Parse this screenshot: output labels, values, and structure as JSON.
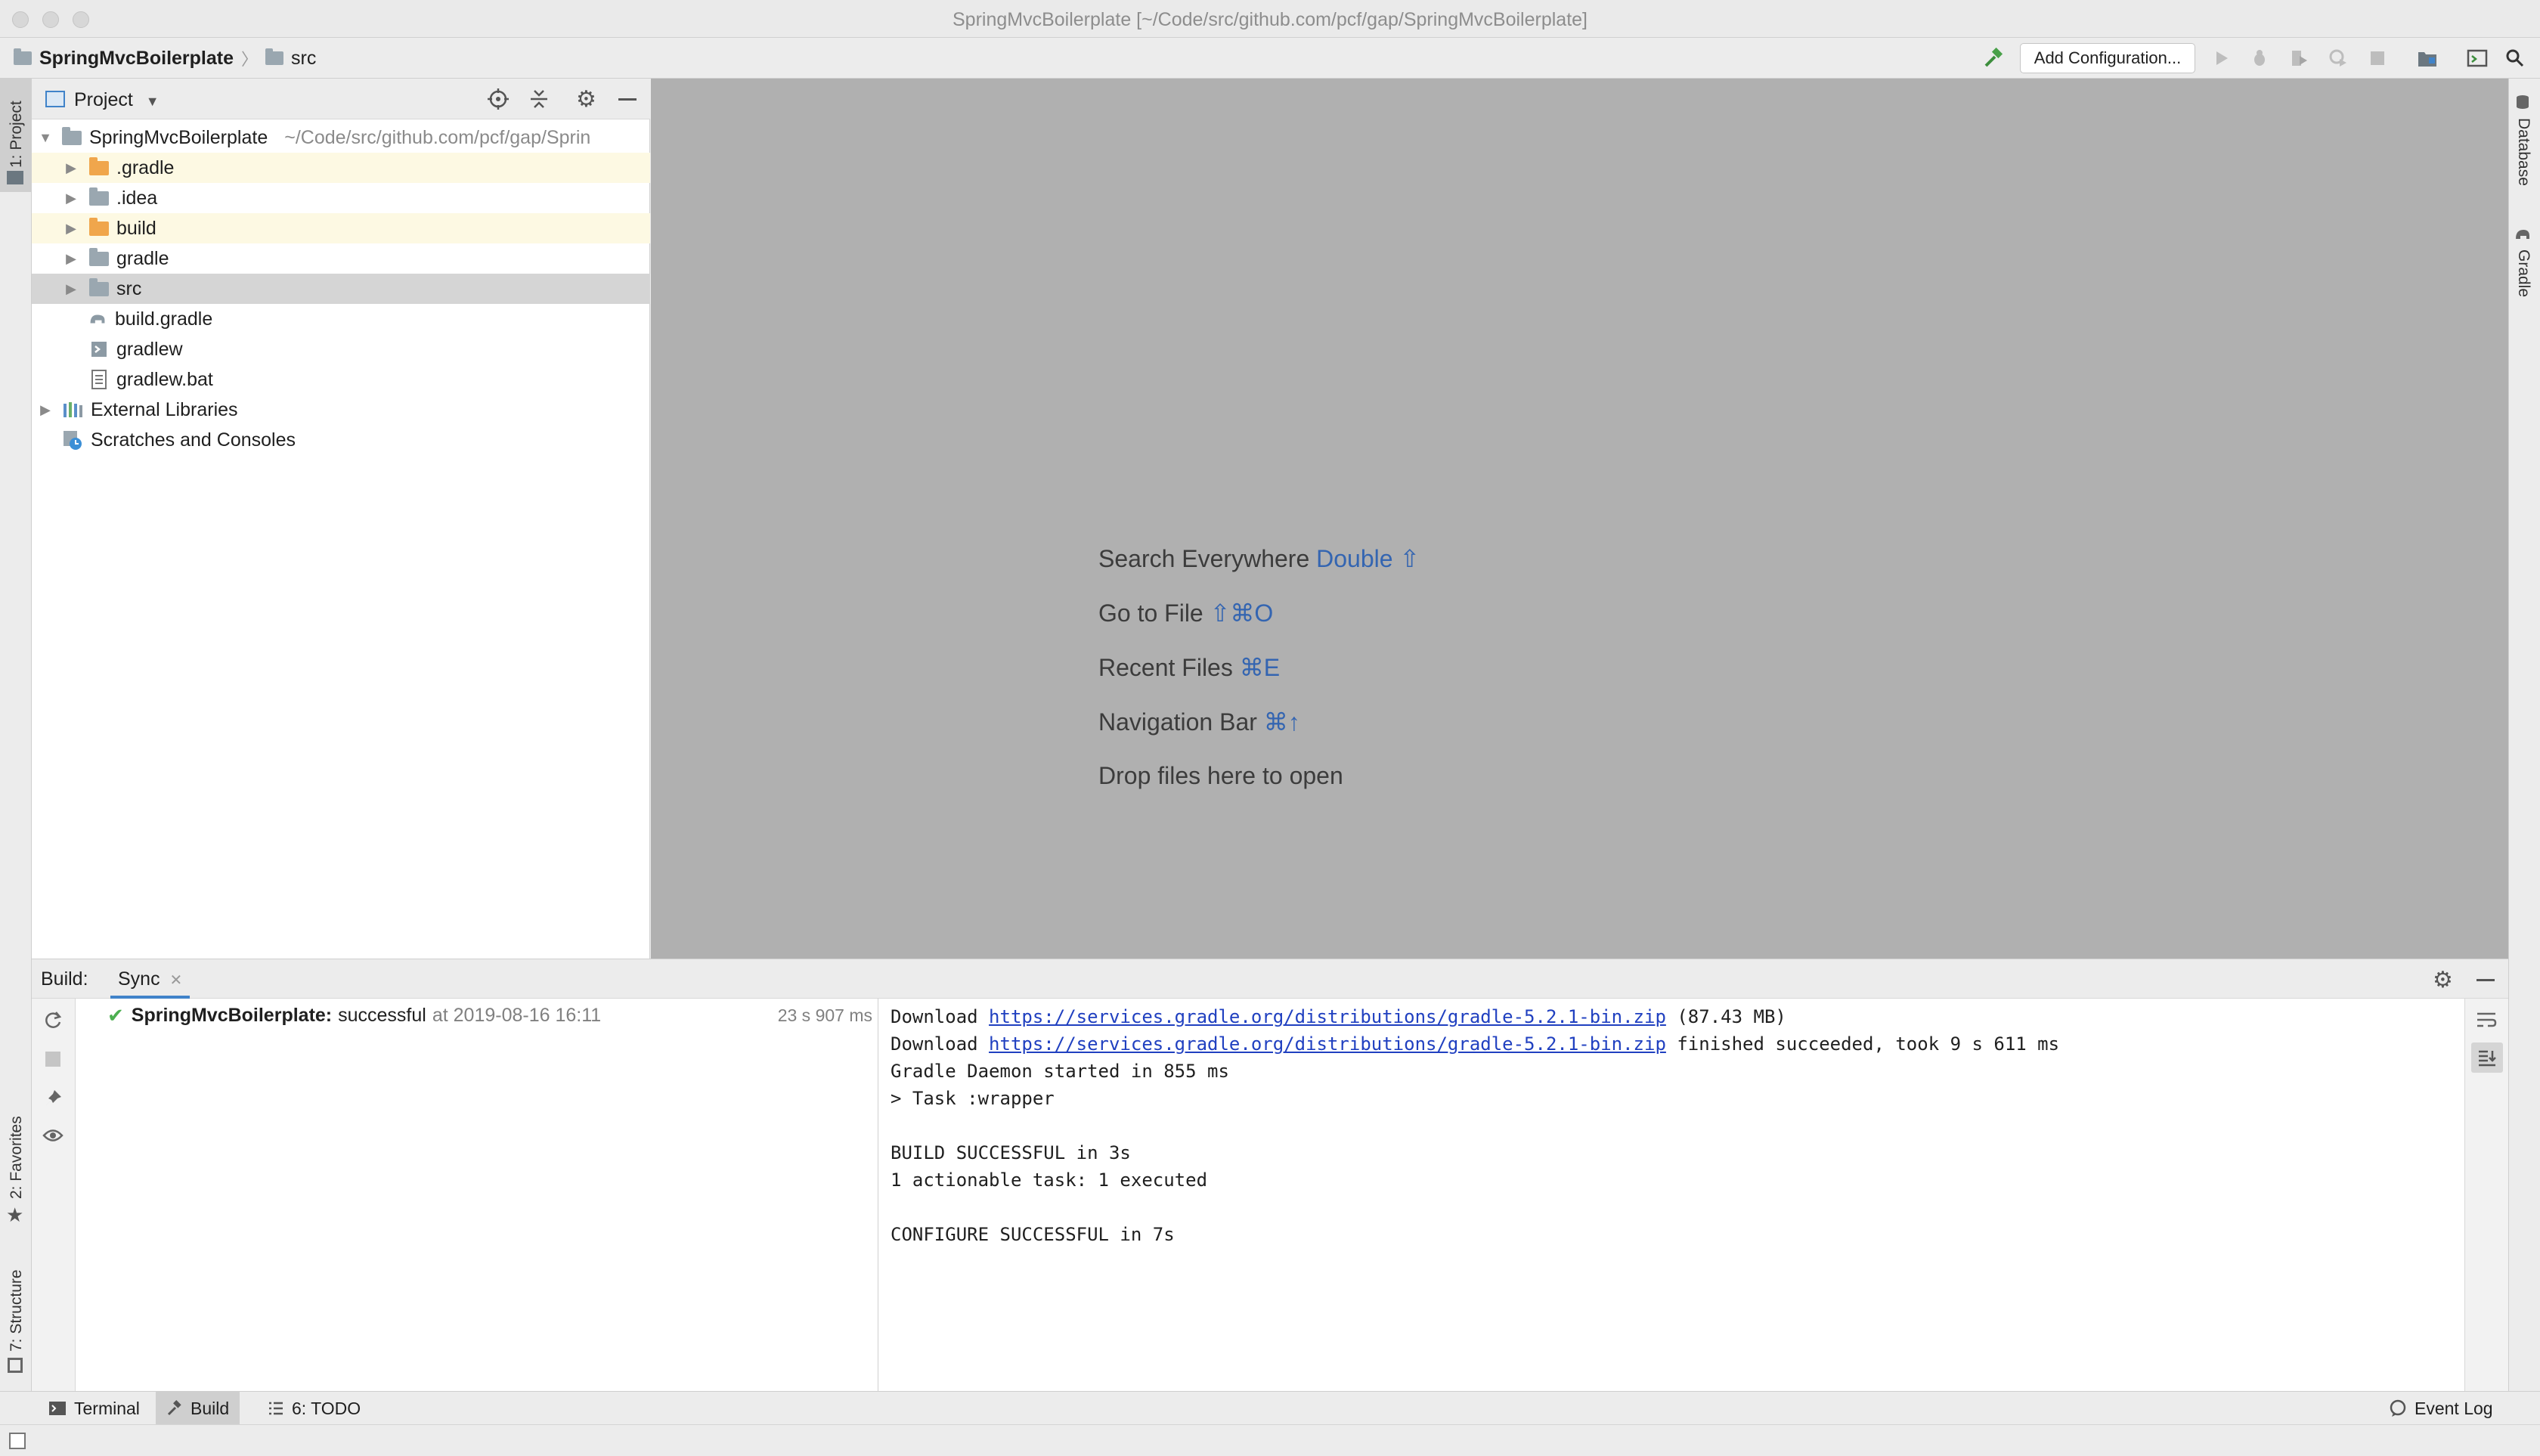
{
  "window": {
    "title": "SpringMvcBoilerplate [~/Code/src/github.com/pcf/gap/SpringMvcBoilerplate]"
  },
  "navbar": {
    "project": "SpringMvcBoilerplate",
    "folder": "src",
    "add_configuration": "Add Configuration...",
    "icons": [
      "build-hammer-icon",
      "run-icon",
      "debug-icon",
      "coverage-icon",
      "profile-icon",
      "stop-icon",
      "project-structure-icon",
      "terminal-window-icon",
      "search-icon"
    ]
  },
  "stripes": {
    "project_tab": "1: Project",
    "favorites_tab": "2: Favorites",
    "structure_tab": "7: Structure",
    "database_tab": "Database",
    "gradle_tab": "Gradle"
  },
  "project_panel": {
    "title": "Project",
    "root": {
      "name": "SpringMvcBoilerplate",
      "path": "~/Code/src/github.com/pcf/gap/Sprin"
    },
    "items": [
      {
        "label": ".gradle"
      },
      {
        "label": ".idea"
      },
      {
        "label": "build"
      },
      {
        "label": "gradle"
      },
      {
        "label": "src"
      },
      {
        "label": "build.gradle"
      },
      {
        "label": "gradlew"
      },
      {
        "label": "gradlew.bat"
      }
    ],
    "external_libraries": "External Libraries",
    "scratches": "Scratches and Consoles"
  },
  "editor_hints": {
    "search_text": "Search Everywhere",
    "search_key": "Double ⇧",
    "goto_text": "Go to File",
    "goto_key": "⇧⌘O",
    "recent_text": "Recent Files",
    "recent_key": "⌘E",
    "nav_text": "Navigation Bar",
    "nav_key": "⌘↑",
    "drop_text": "Drop files here to open"
  },
  "build": {
    "label": "Build:",
    "tab": "Sync",
    "result_project": "SpringMvcBoilerplate:",
    "result_status": "successful",
    "result_time": "at 2019-08-16 16:11",
    "duration": "23 s 907 ms",
    "console": {
      "l1_prefix": "Download ",
      "l1_link": "https://services.gradle.org/distributions/gradle-5.2.1-bin.zip",
      "l1_suffix": " (87.43 MB)",
      "l2_prefix": "Download ",
      "l2_link": "https://services.gradle.org/distributions/gradle-5.2.1-bin.zip",
      "l2_suffix": " finished succeeded, took 9 s 611 ms",
      "l3": "Gradle Daemon started in 855 ms",
      "l4": "> Task :wrapper",
      "l5": "BUILD SUCCESSFUL in 3s",
      "l6": "1 actionable task: 1 executed",
      "l7": "CONFIGURE SUCCESSFUL in 7s"
    }
  },
  "bottom_tabs": {
    "terminal": "Terminal",
    "build": "Build",
    "todo": "6: TODO",
    "event_log": "Event Log"
  },
  "colors": {
    "accent": "#4083c9",
    "link": "#2040c0",
    "success": "#4caf50",
    "folder_excluded": "#f0a64c",
    "folder": "#9aa7b0"
  }
}
